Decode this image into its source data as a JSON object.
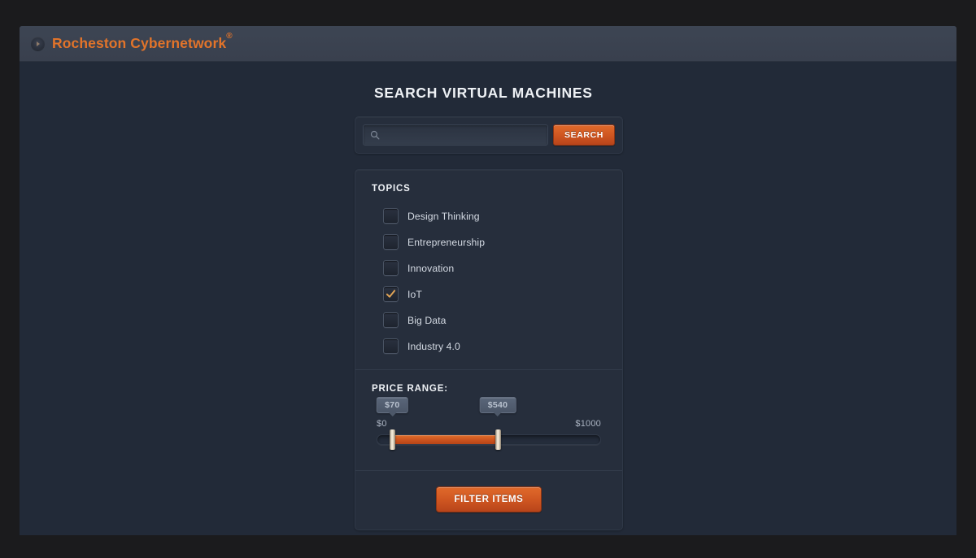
{
  "header": {
    "brand_name": "Rocheston Cybernetwork",
    "brand_superscript": "®",
    "logo_icon": "play-circle-icon"
  },
  "main": {
    "page_title": "SEARCH VIRTUAL MACHINES",
    "search": {
      "icon": "search-icon",
      "value": "",
      "placeholder": "",
      "button_label": "SEARCH"
    },
    "topics": {
      "title": "TOPICS",
      "items": [
        {
          "label": "Design Thinking",
          "checked": false
        },
        {
          "label": "Entrepreneurship",
          "checked": false
        },
        {
          "label": "Innovation",
          "checked": false
        },
        {
          "label": "IoT",
          "checked": true
        },
        {
          "label": "Big Data",
          "checked": false
        },
        {
          "label": "Industry 4.0",
          "checked": false
        }
      ]
    },
    "price_range": {
      "title": "PRICE RANGE:",
      "min_label": "$0",
      "max_label": "$1000",
      "min_value_label": "$70",
      "max_value_label": "$540",
      "min_value": 70,
      "max_value": 540,
      "range_min": 0,
      "range_max": 1000
    },
    "filter_button_label": "FILTER ITEMS"
  },
  "colors": {
    "accent_orange": "#d45a23",
    "brand_text": "#e2742a",
    "panel_bg": "#222a38",
    "card_bg": "#262e3c",
    "page_bg": "#1b1b1d",
    "topbar_bg": "#3d4553"
  }
}
